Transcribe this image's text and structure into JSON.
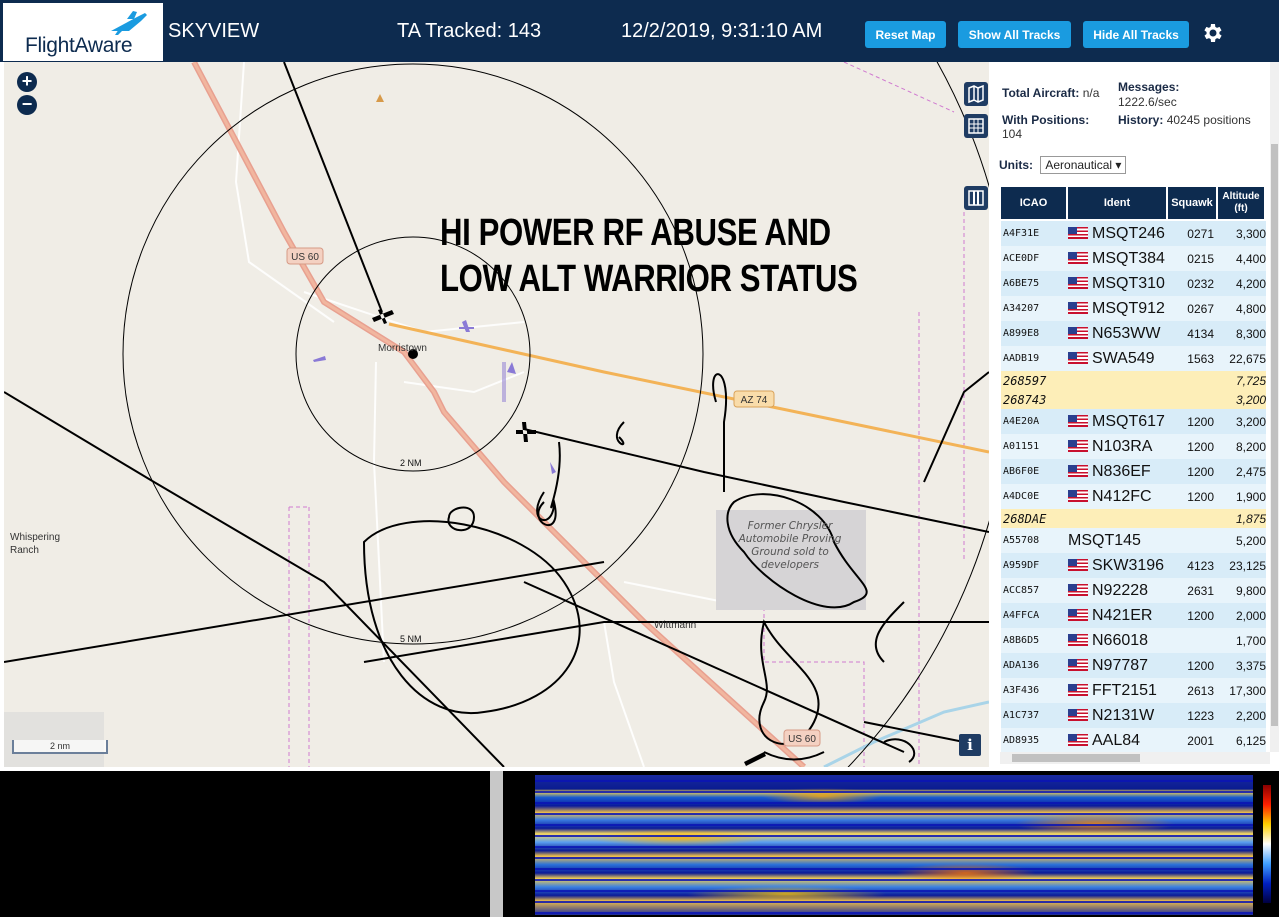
{
  "header": {
    "logo_text": "FlightAware",
    "app_title": "SKYVIEW",
    "tracked_label": "TA Tracked: 143",
    "clock": "12/2/2019, 9:31:10 AM",
    "buttons": {
      "reset": "Reset Map",
      "show_all": "Show All Tracks",
      "hide_all": "Hide All Tracks"
    },
    "accent_color": "#1a9be0",
    "bar_color": "#0d2b4f"
  },
  "map": {
    "overlay_text": "HI POWER RF ABUSE AND LOW ALT WARRIOR STATUS",
    "labels": {
      "morristown": "Morristown",
      "whispering_ranch": "Whispering Ranch",
      "wittmann": "Wittmann",
      "us60_a": "US 60",
      "us60_b": "US 60",
      "az74": "AZ 74",
      "ring_2nm": "2 NM",
      "ring_5nm": "5 NM",
      "proving_ground": "Former Chrysler Automobile Proving Ground sold to developers"
    },
    "scale_label": "2 nm",
    "zoom_in": "+",
    "zoom_out": "−",
    "info": "i"
  },
  "sidebar": {
    "total_aircraft_label": "Total Aircraft:",
    "total_aircraft_value": "n/a",
    "messages_label": "Messages:",
    "messages_value": "1222.6/sec",
    "with_positions_label": "With Positions:",
    "with_positions_value": "104",
    "history_label": "History:",
    "history_value": "40245 positions",
    "units_label": "Units:",
    "units_value": "Aeronautical",
    "columns": [
      "ICAO",
      "Ident",
      "Squawk",
      "Altitude (ft)"
    ],
    "rows": [
      {
        "icao": "A4F31E",
        "ident": "MSQT246",
        "squawk": "0271",
        "alt": "3,300",
        "flag": true,
        "nopos": false
      },
      {
        "icao": "ACE0DF",
        "ident": "MSQT384",
        "squawk": "0215",
        "alt": "4,400",
        "flag": true,
        "nopos": false
      },
      {
        "icao": "A6BE75",
        "ident": "MSQT310",
        "squawk": "0232",
        "alt": "4,200",
        "flag": true,
        "nopos": false
      },
      {
        "icao": "A34207",
        "ident": "MSQT912",
        "squawk": "0267",
        "alt": "4,800",
        "flag": true,
        "nopos": false
      },
      {
        "icao": "A899E8",
        "ident": "N653WW",
        "squawk": "4134",
        "alt": "8,300",
        "flag": true,
        "nopos": false
      },
      {
        "icao": "AADB19",
        "ident": "SWA549",
        "squawk": "1563",
        "alt": "22,675",
        "flag": true,
        "nopos": false
      },
      {
        "icao": "268597",
        "ident": "",
        "squawk": "",
        "alt": "7,725",
        "flag": false,
        "nopos": true
      },
      {
        "icao": "268743",
        "ident": "",
        "squawk": "",
        "alt": "3,200",
        "flag": false,
        "nopos": true
      },
      {
        "icao": "A4E20A",
        "ident": "MSQT617",
        "squawk": "1200",
        "alt": "3,200",
        "flag": true,
        "nopos": false
      },
      {
        "icao": "A01151",
        "ident": "N103RA",
        "squawk": "1200",
        "alt": "8,200",
        "flag": true,
        "nopos": false
      },
      {
        "icao": "AB6F0E",
        "ident": "N836EF",
        "squawk": "1200",
        "alt": "2,475",
        "flag": true,
        "nopos": false
      },
      {
        "icao": "A4DC0E",
        "ident": "N412FC",
        "squawk": "1200",
        "alt": "1,900",
        "flag": true,
        "nopos": false
      },
      {
        "icao": "268DAE",
        "ident": "",
        "squawk": "",
        "alt": "1,875",
        "flag": false,
        "nopos": true
      },
      {
        "icao": "A55708",
        "ident": "MSQT145",
        "squawk": "",
        "alt": "5,200",
        "flag": false,
        "nopos": false
      },
      {
        "icao": "A959DF",
        "ident": "SKW3196",
        "squawk": "4123",
        "alt": "23,125",
        "flag": true,
        "nopos": false
      },
      {
        "icao": "ACC857",
        "ident": "N92228",
        "squawk": "2631",
        "alt": "9,800",
        "flag": true,
        "nopos": false
      },
      {
        "icao": "A4FFCA",
        "ident": "N421ER",
        "squawk": "1200",
        "alt": "2,000",
        "flag": true,
        "nopos": false
      },
      {
        "icao": "A8B6D5",
        "ident": "N66018",
        "squawk": "",
        "alt": "1,700",
        "flag": true,
        "nopos": false
      },
      {
        "icao": "ADA136",
        "ident": "N97787",
        "squawk": "1200",
        "alt": "3,375",
        "flag": true,
        "nopos": false
      },
      {
        "icao": "A3F436",
        "ident": "FFT2151",
        "squawk": "2613",
        "alt": "17,300",
        "flag": true,
        "nopos": false
      },
      {
        "icao": "A1C737",
        "ident": "N2131W",
        "squawk": "1223",
        "alt": "2,200",
        "flag": true,
        "nopos": false
      },
      {
        "icao": "AD8935",
        "ident": "AAL84",
        "squawk": "2001",
        "alt": "6,125",
        "flag": true,
        "nopos": false
      }
    ]
  }
}
